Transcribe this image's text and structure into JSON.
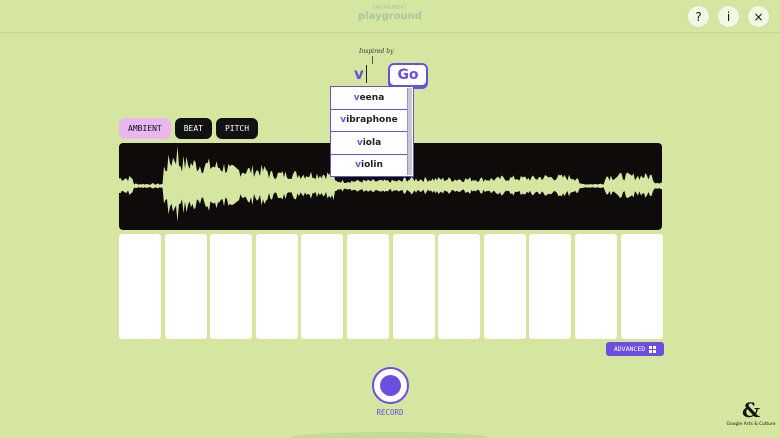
{
  "header": {
    "logo_line1": "INSTRUMENT",
    "logo_line2": "playground",
    "help_label": "?",
    "info_label": "i",
    "close_label": "×"
  },
  "search": {
    "inspired_label": "Inspired by",
    "query": "v",
    "go_label": "Go",
    "suggestions": [
      {
        "match": "v",
        "rest": "eena"
      },
      {
        "match": "v",
        "rest": "ibraphone"
      },
      {
        "match": "v",
        "rest": "iola"
      },
      {
        "match": "v",
        "rest": "iolin"
      }
    ]
  },
  "modes": {
    "ambient": "AMBIENT",
    "beat": "BEAT",
    "pitch": "PITCH",
    "selected": "AMBIENT"
  },
  "keyboard": {
    "key_count": 12
  },
  "advanced_label": "ADVANCED",
  "record_label": "RECORD",
  "footer": {
    "brand": "Google Arts & Culture"
  },
  "colors": {
    "background": "#d4e6a0",
    "accent": "#6b4fe0",
    "active_tab": "#e9b6ef",
    "waveform": "#d4e6a0",
    "panel": "#0f0b0a"
  },
  "icons": [
    "help-icon",
    "info-icon",
    "close-icon",
    "grid-icon",
    "record-icon",
    "google-arts-culture-logo"
  ]
}
